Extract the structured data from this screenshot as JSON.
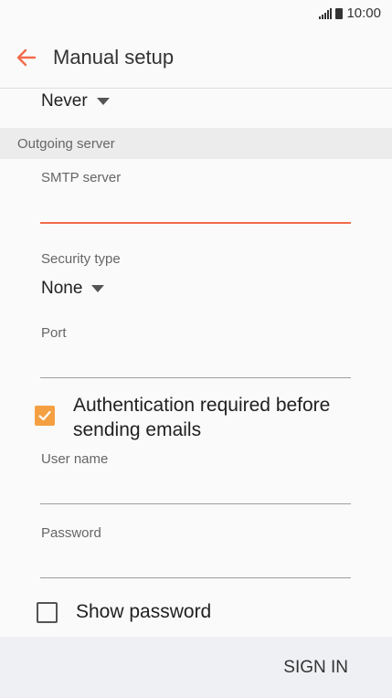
{
  "status_bar": {
    "time": "10:00"
  },
  "header": {
    "title": "Manual setup"
  },
  "top_value": {
    "selected": "Never"
  },
  "outgoing": {
    "section_title": "Outgoing server",
    "smtp_label": "SMTP server",
    "smtp_value": "",
    "security_label": "Security type",
    "security_value": "None",
    "port_label": "Port",
    "port_value": ""
  },
  "auth": {
    "label": "Authentication required before sending emails",
    "checked": true,
    "username_label": "User name",
    "username_value": "",
    "password_label": "Password",
    "password_value": ""
  },
  "show_password": {
    "label": "Show password",
    "checked": false
  },
  "footer": {
    "signin_label": "SIGN IN"
  },
  "colors": {
    "accent": "#f26b4a",
    "checkbox": "#f4a042"
  }
}
